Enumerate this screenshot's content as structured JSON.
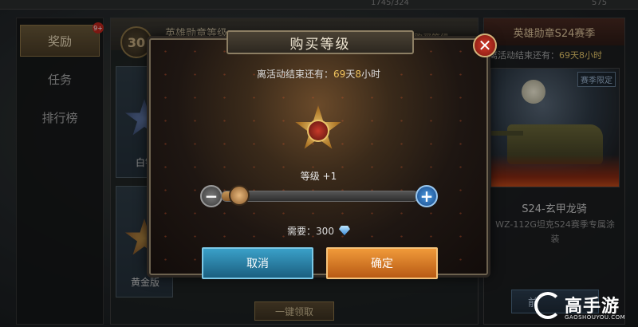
{
  "topstrip": {
    "left_value": "1745/324",
    "right_value": "575"
  },
  "sidebar": {
    "items": [
      {
        "label": "奖励",
        "badge": "9+"
      },
      {
        "label": "任务"
      },
      {
        "label": "排行榜"
      }
    ]
  },
  "background_panel": {
    "level": "30",
    "title": "英雄勋章等级",
    "header_right": "购买等级",
    "cards": [
      {
        "label": "白银"
      },
      {
        "label": "黄金版"
      }
    ],
    "claim_all_button": "一键领取"
  },
  "season_panel": {
    "title": "英雄勋章S24赛季",
    "remaining_label": "离活动结束还有：",
    "remaining_value": "69天8小时",
    "season_tag": "赛季限定",
    "reward_name": "S24-玄甲龙骑",
    "reward_desc": "WZ-112G坦克S24赛季专属涂装",
    "button_label": "前"
  },
  "modal": {
    "title": "购买等级",
    "remaining_label": "离活动结束还有：",
    "remaining_days": "69",
    "remaining_days_unit": "天",
    "remaining_hours": "8",
    "remaining_hours_unit": "小时",
    "level_label": "等级 +1",
    "slider_value": 0.05,
    "cost_label": "需要：",
    "cost_value": "300",
    "cost_icon": "diamond-icon",
    "cancel_label": "取消",
    "confirm_label": "确定",
    "close_icon": "close-icon"
  },
  "watermark": {
    "text": "高手游",
    "sub": "GAOSHOUYOU.COM"
  },
  "colors": {
    "accent_gold": "#f0c45e",
    "cancel_blue": "#3aa0c8",
    "confirm_orange": "#f09a3a",
    "close_red": "#d23a2a"
  }
}
